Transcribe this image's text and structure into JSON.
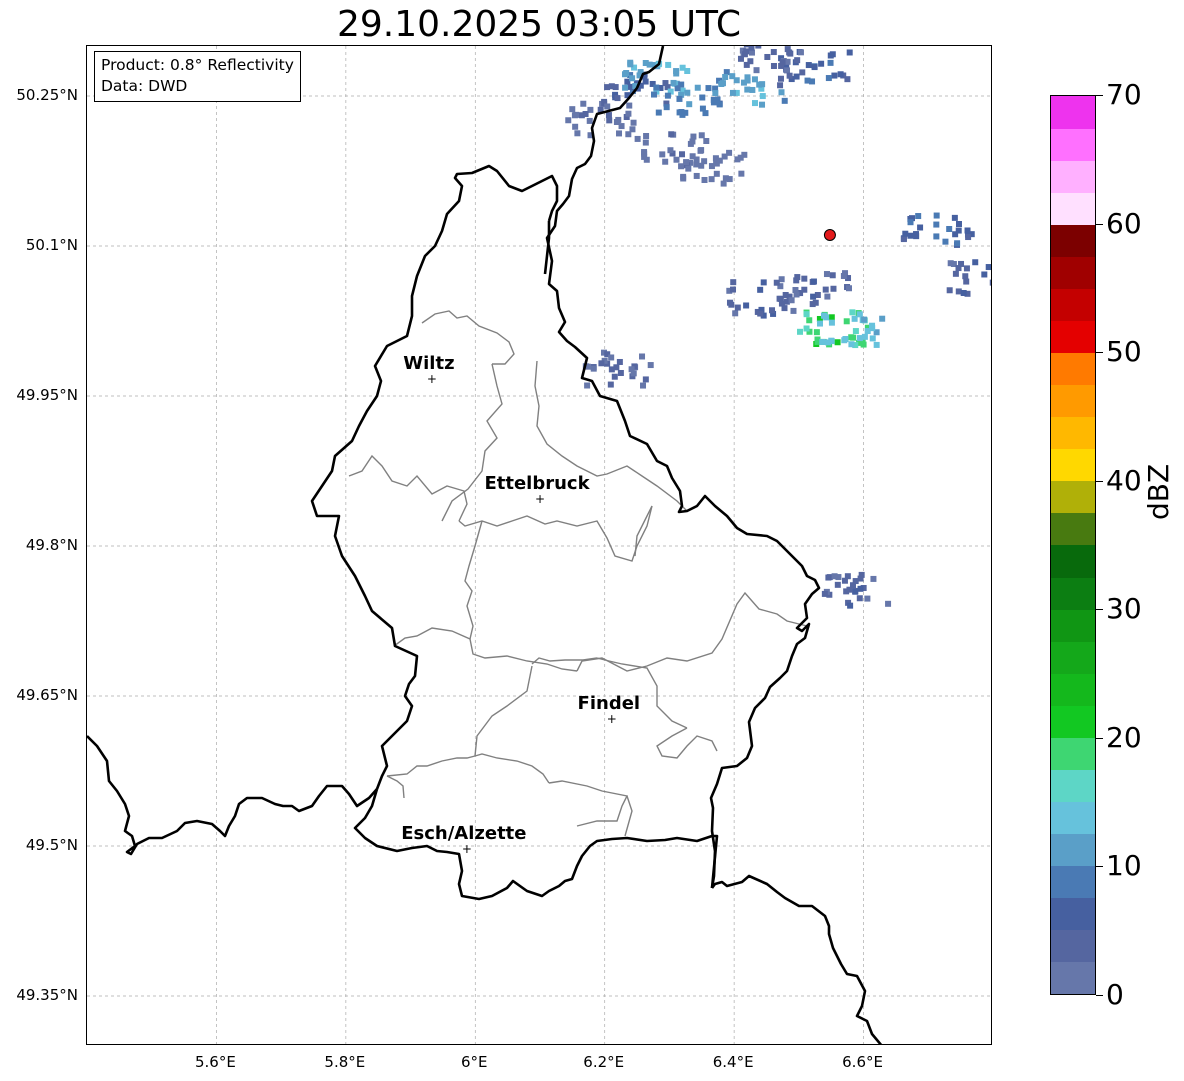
{
  "title": "29.10.2025 03:05 UTC",
  "info": {
    "product": "Product: 0.8° Reflectivity",
    "source": "Data: DWD"
  },
  "axes": {
    "lat_labels": [
      "50.25°N",
      "50.1°N",
      "49.95°N",
      "49.8°N",
      "49.65°N",
      "49.5°N",
      "49.35°N"
    ],
    "lon_labels": [
      "5.6°E",
      "5.8°E",
      "6°E",
      "6.2°E",
      "6.4°E",
      "6.6°E"
    ],
    "lat_values": [
      50.25,
      50.1,
      49.95,
      49.8,
      49.65,
      49.5,
      49.35
    ],
    "lon_values": [
      5.6,
      5.8,
      6.0,
      6.2,
      6.4,
      6.6
    ],
    "lat_range": [
      49.3,
      50.3
    ],
    "lon_range": [
      5.4,
      6.8
    ],
    "grid": true
  },
  "places": [
    {
      "name": "Wiltz",
      "lat": 49.967,
      "lon": 5.933
    },
    {
      "name": "Ettelbruck",
      "lat": 49.847,
      "lon": 6.1
    },
    {
      "name": "Findel",
      "lat": 49.627,
      "lon": 6.211
    },
    {
      "name": "Esch/Alzette",
      "lat": 49.497,
      "lon": 5.987
    }
  ],
  "radar_marker": {
    "lat": 50.111,
    "lon": 6.548,
    "color": "#e31a1c"
  },
  "colorbar": {
    "label": "dBZ",
    "min": 0,
    "max": 70,
    "ticks": [
      "0",
      "10",
      "20",
      "30",
      "40",
      "50",
      "60",
      "70"
    ],
    "colors": [
      "#6677aa",
      "#5566a0",
      "#4660a0",
      "#4a7ab4",
      "#5a9fc8",
      "#66c2dc",
      "#5dd6c6",
      "#3ed672",
      "#12c822",
      "#14b81c",
      "#14a81a",
      "#109614",
      "#0c7e12",
      "#086a0c",
      "#487a10",
      "#b0b008",
      "#ffd800",
      "#ffb800",
      "#ff9a00",
      "#ff7a00",
      "#e40000",
      "#c40000",
      "#a00000",
      "#7c0000",
      "#ffe0ff",
      "#ffb0ff",
      "#ff70ff",
      "#ee33ee"
    ]
  },
  "echoes": [
    {
      "lat": 50.26,
      "lon": 6.24,
      "dbz": 8
    },
    {
      "lat": 50.27,
      "lon": 6.28,
      "dbz": 15
    },
    {
      "lat": 50.25,
      "lon": 6.32,
      "dbz": 12
    },
    {
      "lat": 50.23,
      "lon": 6.19,
      "dbz": 5
    },
    {
      "lat": 50.26,
      "lon": 6.42,
      "dbz": 14
    },
    {
      "lat": 50.28,
      "lon": 6.52,
      "dbz": 9
    },
    {
      "lat": 50.29,
      "lon": 6.45,
      "dbz": 6
    },
    {
      "lat": 50.2,
      "lon": 6.3,
      "dbz": 4
    },
    {
      "lat": 50.18,
      "lon": 6.36,
      "dbz": 3
    },
    {
      "lat": 50.06,
      "lon": 6.52,
      "dbz": 6
    },
    {
      "lat": 50.05,
      "lon": 6.44,
      "dbz": 7
    },
    {
      "lat": 50.02,
      "lon": 6.55,
      "dbz": 22
    },
    {
      "lat": 50.02,
      "lon": 6.58,
      "dbz": 16
    },
    {
      "lat": 50.12,
      "lon": 6.71,
      "dbz": 10
    },
    {
      "lat": 50.07,
      "lon": 6.78,
      "dbz": 7
    },
    {
      "lat": 49.98,
      "lon": 6.22,
      "dbz": 5
    },
    {
      "lat": 49.76,
      "lon": 6.58,
      "dbz": 6
    }
  ]
}
